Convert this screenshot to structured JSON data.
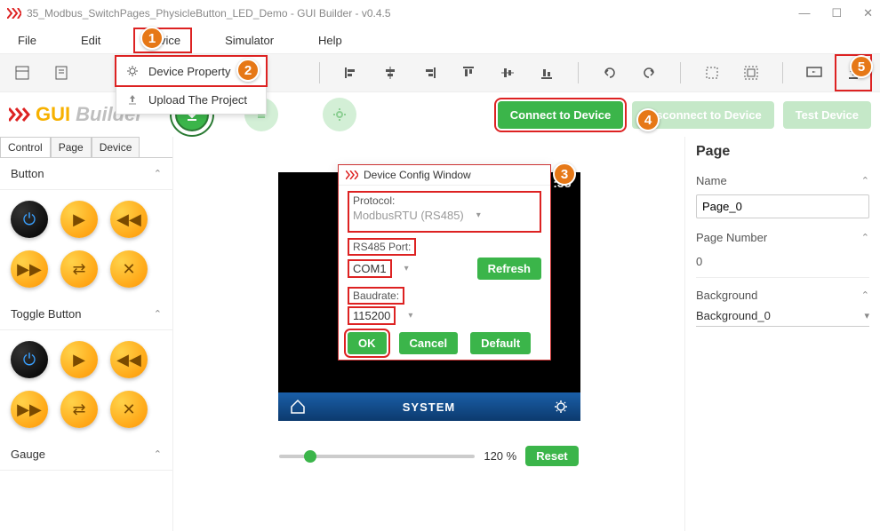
{
  "window": {
    "title": "35_Modbus_SwitchPages_PhysicleButton_LED_Demo - GUI Builder - v0.4.5"
  },
  "menu": {
    "file": "File",
    "edit": "Edit",
    "device": "Device",
    "simulator": "Simulator",
    "help": "Help"
  },
  "device_menu": {
    "property": "Device Property",
    "upload": "Upload The Project"
  },
  "actions": {
    "connect": "Connect to Device",
    "disconnect": "Disconnect to Device",
    "test": "Test Device"
  },
  "brand": {
    "g": "GUI",
    "rest": " Builder"
  },
  "left": {
    "tabs": {
      "control": "Control",
      "page": "Page",
      "device": "Device"
    },
    "sections": {
      "button": "Button",
      "toggle": "Toggle Button",
      "gauge": "Gauge"
    }
  },
  "dialog": {
    "title": "Device Config Window",
    "protocol_label": "Protocol:",
    "protocol_value": "ModbusRTU (RS485)",
    "port_label": "RS485 Port:",
    "port_value": "COM1",
    "refresh": "Refresh",
    "baud_label": "Baudrate:",
    "baud_value": "115200",
    "ok": "OK",
    "cancel": "Cancel",
    "default": "Default"
  },
  "stage": {
    "time": ":35",
    "title": "SYSTEM"
  },
  "zoom": {
    "percent": "120 %",
    "reset": "Reset"
  },
  "right": {
    "title": "Page",
    "name_label": "Name",
    "name_value": "Page_0",
    "num_label": "Page Number",
    "num_value": "0",
    "bg_label": "Background",
    "bg_value": "Background_0"
  },
  "badges": {
    "b1": "1",
    "b2": "2",
    "b3": "3",
    "b4": "4",
    "b5": "5"
  }
}
